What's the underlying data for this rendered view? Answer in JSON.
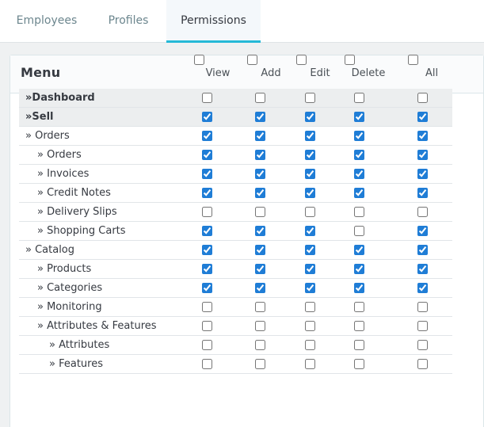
{
  "tabs": [
    {
      "label": "Employees",
      "active": false
    },
    {
      "label": "Profiles",
      "active": false
    },
    {
      "label": "Permissions",
      "active": true
    }
  ],
  "menu": {
    "title": "Menu",
    "columns": [
      "View",
      "Add",
      "Edit",
      "Delete",
      "All"
    ],
    "rows": [
      {
        "label": "»Dashboard",
        "level": 0,
        "group": true,
        "checks": [
          false,
          false,
          false,
          false,
          false
        ]
      },
      {
        "label": "»Sell",
        "level": 0,
        "group": true,
        "checks": [
          true,
          true,
          true,
          true,
          true
        ]
      },
      {
        "label": "» Orders",
        "level": 1,
        "group": false,
        "checks": [
          true,
          true,
          true,
          true,
          true
        ]
      },
      {
        "label": "» Orders",
        "level": 2,
        "group": false,
        "checks": [
          true,
          true,
          true,
          true,
          true
        ]
      },
      {
        "label": "» Invoices",
        "level": 2,
        "group": false,
        "checks": [
          true,
          true,
          true,
          true,
          true
        ]
      },
      {
        "label": "» Credit Notes",
        "level": 2,
        "group": false,
        "checks": [
          true,
          true,
          true,
          true,
          true
        ]
      },
      {
        "label": "» Delivery Slips",
        "level": 2,
        "group": false,
        "checks": [
          false,
          false,
          false,
          false,
          false
        ]
      },
      {
        "label": "» Shopping Carts",
        "level": 2,
        "group": false,
        "checks": [
          true,
          true,
          true,
          false,
          true
        ]
      },
      {
        "label": "» Catalog",
        "level": 1,
        "group": false,
        "checks": [
          true,
          true,
          true,
          true,
          true
        ]
      },
      {
        "label": "» Products",
        "level": 2,
        "group": false,
        "checks": [
          true,
          true,
          true,
          true,
          true
        ]
      },
      {
        "label": "» Categories",
        "level": 2,
        "group": false,
        "checks": [
          true,
          true,
          true,
          true,
          true
        ]
      },
      {
        "label": "» Monitoring",
        "level": 2,
        "group": false,
        "checks": [
          false,
          false,
          false,
          false,
          false
        ]
      },
      {
        "label": "» Attributes & Features",
        "level": 2,
        "group": false,
        "checks": [
          false,
          false,
          false,
          false,
          false
        ]
      },
      {
        "label": "» Attributes",
        "level": 3,
        "group": false,
        "checks": [
          false,
          false,
          false,
          false,
          false
        ]
      },
      {
        "label": "» Features",
        "level": 3,
        "group": false,
        "checks": [
          false,
          false,
          false,
          false,
          false
        ]
      }
    ]
  }
}
